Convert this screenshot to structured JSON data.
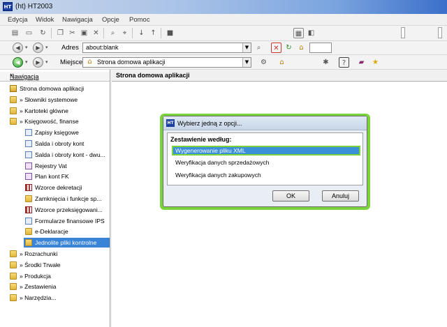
{
  "window": {
    "icon_text": "HT",
    "title": "(ht)  HT2003"
  },
  "menu": [
    "Edycja",
    "Widok",
    "Nawigacja",
    "Opcje",
    "Pomoc"
  ],
  "address_bar": {
    "label": "Adres",
    "value": "about:blank"
  },
  "location_bar": {
    "label": "Miejsce",
    "value": "Strona domowa aplikacji"
  },
  "nav_panel": {
    "tab_label": "Nawigacja",
    "close_glyph": "×",
    "items": [
      {
        "label": "Strona domowa aplikacji",
        "icon": "home-icon"
      },
      {
        "label": "» Słowniki systemowe",
        "icon": "folder-icon"
      },
      {
        "label": "» Kartoteki główne",
        "icon": "folder-icon"
      },
      {
        "label": "» Księgowość, finanse",
        "icon": "folder-icon"
      },
      {
        "label": "Zapisy księgowe",
        "icon": "document-icon"
      },
      {
        "label": "Salda i obroty kont",
        "icon": "document-icon"
      },
      {
        "label": "Salda i obroty kont - dwu...",
        "icon": "document-icon"
      },
      {
        "label": "Rejestry Vat",
        "icon": "register-icon"
      },
      {
        "label": "Plan kont FK",
        "icon": "chart-of-accounts-icon"
      },
      {
        "label": "Wzorce dekretacji",
        "icon": "grid-icon"
      },
      {
        "label": "Zamknięcia i funkcje sp...",
        "icon": "folder-icon"
      },
      {
        "label": "Wzorce przeksięgowani...",
        "icon": "grid-icon"
      },
      {
        "label": "Formularze finansowe IPS",
        "icon": "form-icon"
      },
      {
        "label": "e-Deklaracje",
        "icon": "folder-icon"
      },
      {
        "label": "Jednolite pliki kontrolne",
        "icon": "folder-icon"
      },
      {
        "label": "» Rozrachunki",
        "icon": "folder-icon"
      },
      {
        "label": "» Środki Trwałe",
        "icon": "folder-icon"
      },
      {
        "label": "» Produkcja",
        "icon": "folder-icon"
      },
      {
        "label": "» Zestawienia",
        "icon": "folder-icon"
      },
      {
        "label": "» Narzędzia...",
        "icon": "folder-icon"
      }
    ],
    "selected_index": 14
  },
  "content_header": "Strona domowa aplikacji",
  "dialog": {
    "icon_text": "HT",
    "title": "Wybierz jedną z opcji...",
    "heading": "Zestawienie według:",
    "options": [
      "Wygenerowanie pliku XML",
      "Weryfikacja danych sprzedażowych",
      "Weryfikacja danych zakupowych"
    ],
    "selected_option": 0,
    "ok_label": "OK",
    "cancel_label": "Anuluj"
  },
  "accent_color": "#3b8ed8",
  "highlight_color": "#7bd33c"
}
